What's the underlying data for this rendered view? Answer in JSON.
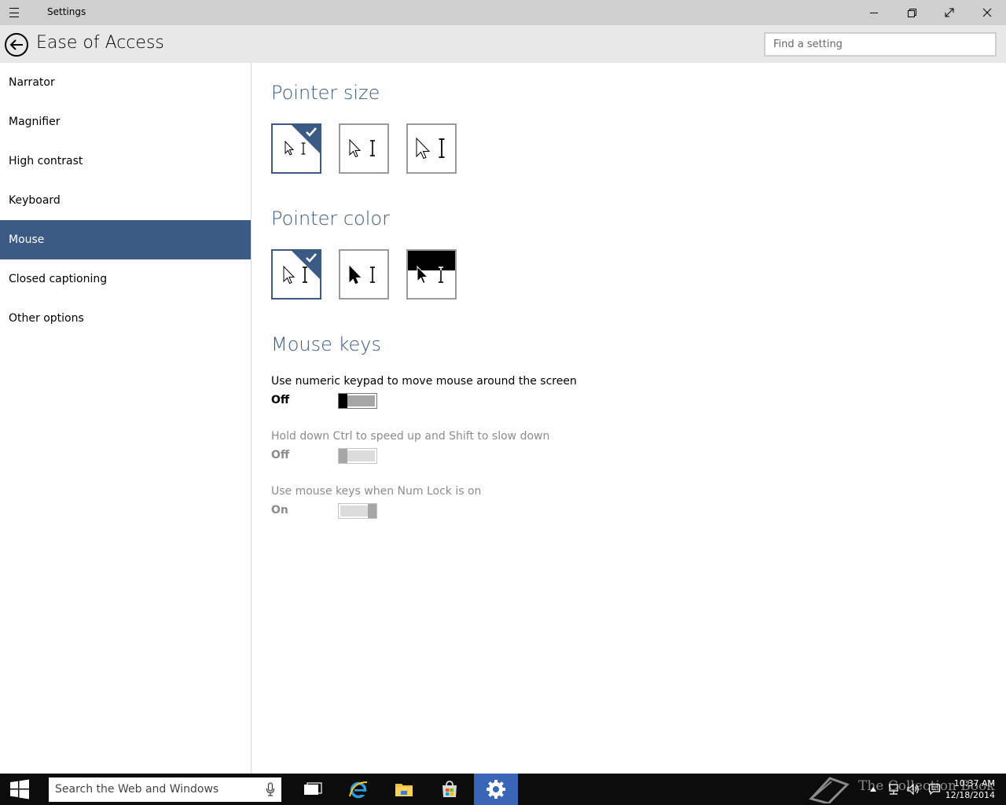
{
  "window": {
    "title": "Settings"
  },
  "header": {
    "title": "Ease of Access",
    "search_placeholder": "Find a setting"
  },
  "sidebar": {
    "items": [
      {
        "label": "Narrator"
      },
      {
        "label": "Magnifier"
      },
      {
        "label": "High contrast"
      },
      {
        "label": "Keyboard"
      },
      {
        "label": "Mouse",
        "selected": true
      },
      {
        "label": "Closed captioning"
      },
      {
        "label": "Other options"
      }
    ]
  },
  "main": {
    "pointer_size": {
      "title": "Pointer size",
      "options": [
        "small",
        "medium",
        "large"
      ],
      "selected_index": 0
    },
    "pointer_color": {
      "title": "Pointer color",
      "options": [
        "white",
        "black",
        "inverted"
      ],
      "selected_index": 0
    },
    "mouse_keys": {
      "title": "Mouse keys",
      "settings": [
        {
          "label": "Use numeric keypad to move mouse around the screen",
          "state": "Off",
          "enabled": true
        },
        {
          "label": "Hold down Ctrl to speed up and Shift to slow down",
          "state": "Off",
          "enabled": false
        },
        {
          "label": "Use mouse keys when Num Lock is on",
          "state": "On",
          "enabled": false
        }
      ]
    }
  },
  "taskbar": {
    "search_placeholder": "Search the Web and Windows",
    "watermark": "The Collection Book",
    "time": "10:37 AM",
    "date": "12/18/2014"
  },
  "colors": {
    "accent": "#3b5a84",
    "taskbar": "#0c0c0c",
    "active_app": "#3a66b8"
  }
}
